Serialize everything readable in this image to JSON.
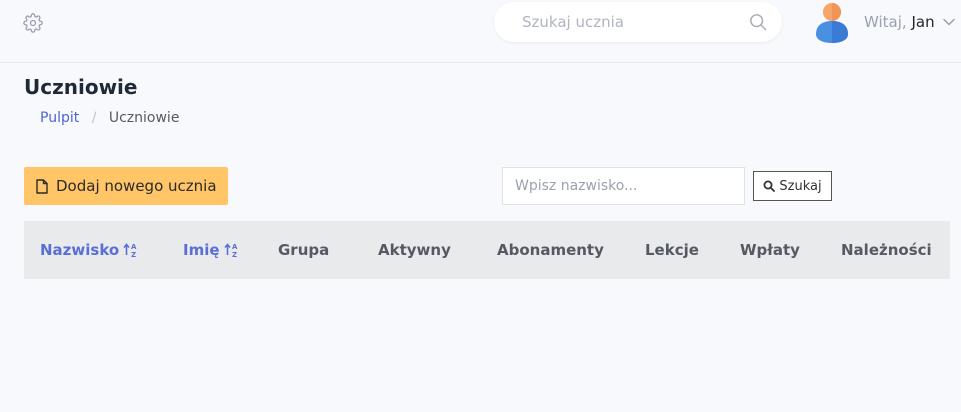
{
  "header": {
    "search_placeholder": "Szukaj ucznia",
    "greeting": "Witaj,",
    "user_name": "Jan"
  },
  "page": {
    "title": "Uczniowie",
    "breadcrumb": [
      {
        "label": "Pulpit",
        "link": true
      },
      {
        "label": "Uczniowie",
        "link": false
      }
    ]
  },
  "toolbar": {
    "add_label": "Dodaj nowego ucznia",
    "name_placeholder": "Wpisz nazwisko...",
    "search_label": "Szukaj"
  },
  "table": {
    "columns": [
      {
        "label": "Nazwisko",
        "sortable": true
      },
      {
        "label": "Imię",
        "sortable": true
      },
      {
        "label": "Grupa",
        "sortable": false
      },
      {
        "label": "Aktywny",
        "sortable": false
      },
      {
        "label": "Abonamenty",
        "sortable": false
      },
      {
        "label": "Lekcje",
        "sortable": false
      },
      {
        "label": "Wpłaty",
        "sortable": false
      },
      {
        "label": "Należności",
        "sortable": false
      }
    ],
    "rows": []
  },
  "colors": {
    "accent": "#5a6fd6",
    "add_button": "#ffc567",
    "header_bg": "#e9eaec"
  }
}
